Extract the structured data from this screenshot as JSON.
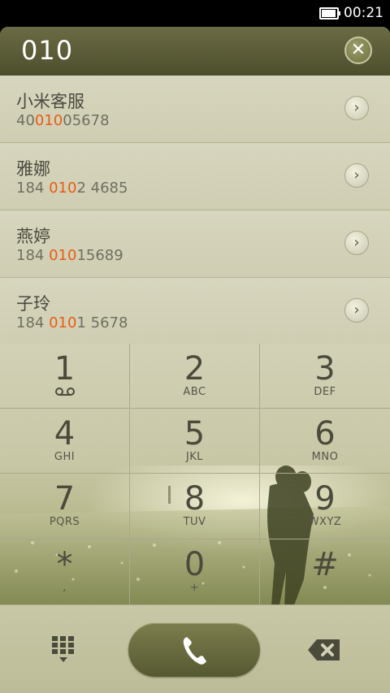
{
  "status_bar": {
    "time": "00:21",
    "battery_level": 0.85
  },
  "header": {
    "query": "010",
    "clear_icon": "close-icon"
  },
  "contacts": [
    {
      "name": "小米客服",
      "number_pre": "40",
      "number_match": "010",
      "number_post": "05678"
    },
    {
      "name": "雅娜",
      "number_pre": "184 ",
      "number_match": "010",
      "number_post": "2 4685"
    },
    {
      "name": "燕婷",
      "number_pre": "184 ",
      "number_match": "010",
      "number_post": "15689"
    },
    {
      "name": "子玲",
      "number_pre": "184 ",
      "number_match": "010",
      "number_post": "1 5678"
    }
  ],
  "keypad": [
    {
      "digit": "1",
      "letters": ""
    },
    {
      "digit": "2",
      "letters": "ABC"
    },
    {
      "digit": "3",
      "letters": "DEF"
    },
    {
      "digit": "4",
      "letters": "GHI"
    },
    {
      "digit": "5",
      "letters": "JKL"
    },
    {
      "digit": "6",
      "letters": "MNO"
    },
    {
      "digit": "7",
      "letters": "PQRS"
    },
    {
      "digit": "8",
      "letters": "TUV"
    },
    {
      "digit": "9",
      "letters": "WXYZ"
    },
    {
      "digit": "*",
      "letters": ","
    },
    {
      "digit": "0",
      "letters": "+"
    },
    {
      "digit": "#",
      "letters": ""
    }
  ],
  "bottom_bar": {
    "left_icon": "dialpad-icon",
    "center_icon": "phone-icon",
    "right_icon": "backspace-icon"
  },
  "colors": {
    "header": "#5a5b36",
    "highlight": "#e85c12",
    "list_bg": "#d3d2b8",
    "call_button": "#6a6c40"
  }
}
